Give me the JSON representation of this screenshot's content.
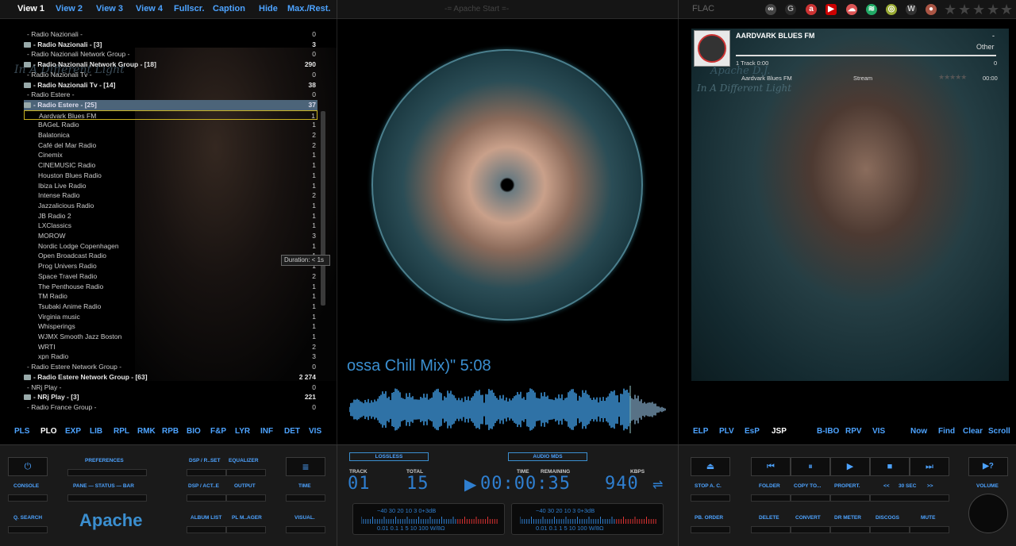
{
  "top_tabs": [
    {
      "label": "View 1",
      "active": true
    },
    {
      "label": "View 2",
      "active": false
    },
    {
      "label": "View 3",
      "active": false
    },
    {
      "label": "View 4",
      "active": false
    },
    {
      "label": "Fullscr.",
      "active": false
    },
    {
      "label": "Caption",
      "active": false
    },
    {
      "label": "Hide",
      "active": false
    },
    {
      "label": "Max./Rest.",
      "active": false
    }
  ],
  "window_title": "-= Apache Start =-",
  "format_label": "FLAC",
  "playlist_rows": [
    {
      "label": "- Radio Nazionali -",
      "count": "0",
      "bold": false,
      "folder": false,
      "indent": 0
    },
    {
      "label": "- Radio Nazionali - [3]",
      "count": "3",
      "bold": true,
      "folder": true,
      "indent": 0
    },
    {
      "label": "- Radio Nazionali Network Group -",
      "count": "0",
      "bold": false,
      "folder": false,
      "indent": 0
    },
    {
      "label": "- Radio Nazionali Network Group - [18]",
      "count": "290",
      "bold": true,
      "folder": true,
      "indent": 0
    },
    {
      "label": "- Radio Nazionali Tv -",
      "count": "0",
      "bold": false,
      "folder": false,
      "indent": 0
    },
    {
      "label": "- Radio Nazionali Tv - [14]",
      "count": "38",
      "bold": true,
      "folder": true,
      "indent": 0
    },
    {
      "label": "- Radio Estere -",
      "count": "0",
      "bold": false,
      "folder": false,
      "indent": 0
    },
    {
      "label": "- Radio Estere - [25]",
      "count": "37",
      "bold": true,
      "folder": true,
      "indent": 0,
      "selected": true
    },
    {
      "label": "Aardvark Blues FM",
      "count": "1",
      "indent": 1,
      "current": true
    },
    {
      "label": "BAGeL Radio",
      "count": "1",
      "indent": 1
    },
    {
      "label": "Balatonica",
      "count": "2",
      "indent": 1
    },
    {
      "label": "Café del Mar Radio",
      "count": "2",
      "indent": 1
    },
    {
      "label": "Cinemix",
      "count": "1",
      "indent": 1
    },
    {
      "label": "CINEMUSIC Radio",
      "count": "1",
      "indent": 1
    },
    {
      "label": "Houston Blues Radio",
      "count": "1",
      "indent": 1
    },
    {
      "label": "Ibiza Live Radio",
      "count": "1",
      "indent": 1
    },
    {
      "label": "Intense Radio",
      "count": "2",
      "indent": 1
    },
    {
      "label": "Jazzalicious Radio",
      "count": "1",
      "indent": 1
    },
    {
      "label": "JB Radio 2",
      "count": "1",
      "indent": 1
    },
    {
      "label": "LXClassics",
      "count": "1",
      "indent": 1
    },
    {
      "label": "MOROW",
      "count": "3",
      "indent": 1
    },
    {
      "label": "Nordic Lodge Copenhagen",
      "count": "1",
      "indent": 1
    },
    {
      "label": "Open Broadcast Radio",
      "count": "1",
      "indent": 1
    },
    {
      "label": "Prog Univers Radio",
      "count": "1",
      "indent": 1
    },
    {
      "label": "Space Travel Radio",
      "count": "2",
      "indent": 1
    },
    {
      "label": "The Penthouse Radio",
      "count": "1",
      "indent": 1
    },
    {
      "label": "TM Radio",
      "count": "1",
      "indent": 1
    },
    {
      "label": "Tsubaki Anime Radio",
      "count": "1",
      "indent": 1
    },
    {
      "label": "Virginia music",
      "count": "1",
      "indent": 1
    },
    {
      "label": "Whisperings",
      "count": "1",
      "indent": 1
    },
    {
      "label": "WJMX Smooth Jazz Boston",
      "count": "1",
      "indent": 1
    },
    {
      "label": "WRTI",
      "count": "2",
      "indent": 1
    },
    {
      "label": "xpn Radio",
      "count": "3",
      "indent": 1
    },
    {
      "label": "- Radio Estere Network Group -",
      "count": "0",
      "bold": false,
      "folder": false,
      "indent": 0
    },
    {
      "label": "- Radio Estere Network Group - [63]",
      "count": "2 274",
      "bold": true,
      "folder": true,
      "indent": 0
    },
    {
      "label": "- NRj Play -",
      "count": "0",
      "bold": false,
      "folder": false,
      "indent": 0
    },
    {
      "label": "- NRj Play - [3]",
      "count": "221",
      "bold": true,
      "folder": true,
      "indent": 0
    },
    {
      "label": "- Radio France Group -",
      "count": "0",
      "bold": false,
      "folder": false,
      "indent": 0
    }
  ],
  "tooltip": "Duration: < 1s",
  "left_tabs": [
    {
      "label": "PLS",
      "active": false
    },
    {
      "label": "PLO",
      "active": true
    },
    {
      "label": "EXP",
      "active": false
    },
    {
      "label": "LIB",
      "active": false
    },
    {
      "label": "RPL",
      "active": false
    },
    {
      "label": "RMK",
      "active": false
    },
    {
      "label": "RPB",
      "active": false
    },
    {
      "label": "BIO",
      "active": false
    },
    {
      "label": "F&P",
      "active": false
    },
    {
      "label": "LYR",
      "active": false
    },
    {
      "label": "INF",
      "active": false
    },
    {
      "label": "DET",
      "active": false
    },
    {
      "label": "VIS",
      "active": false
    }
  ],
  "song_scroll": "ossa Chill Mix)\" 5:08",
  "station": {
    "name": "AARDVARK BLUES FM",
    "dash": "-",
    "genre": "Other",
    "track_info": "1 Track  0:00",
    "track_count": "0",
    "row_name": "Aardvark Blues FM",
    "row_type": "Stream",
    "row_time": "00:00"
  },
  "skin_title": "Apache D.J.",
  "skin_subtitle": "In A Different Light",
  "right_tabs": [
    {
      "label": "ELP",
      "active": false
    },
    {
      "label": "PLV",
      "active": false
    },
    {
      "label": "EsP",
      "active": false
    },
    {
      "label": "JSP",
      "active": true
    },
    {
      "label": "B-IBO",
      "active": false
    },
    {
      "label": "RPV",
      "active": false
    },
    {
      "label": "VIS",
      "active": false
    },
    {
      "label": "Now",
      "active": false
    },
    {
      "label": "Find",
      "active": false
    },
    {
      "label": "Clear",
      "active": false
    },
    {
      "label": "Scroll",
      "active": false
    }
  ],
  "bottom": {
    "app_name": "Apache",
    "labels": {
      "preferences": "PREFERENCES",
      "console": "CONSOLE",
      "pane_status_bar": "PANE — STATUS — BAR",
      "q_search": "Q. SEARCH",
      "dsp_rset": "DSP / R..SET",
      "equalizer": "EQUALIZER",
      "dsp_acte": "DSP / ACT..E",
      "output": "OUTPUT",
      "album_list": "ALBUM LIST",
      "pl_manager": "PL M..AGER",
      "time": "TIME",
      "visual": "VISUAL.",
      "stop_ac": "STOP A. C.",
      "pb_order": "PB. ORDER",
      "folder": "FOLDER",
      "copy_to": "COPY TO...",
      "propert": "PROPERT.",
      "back": "<<",
      "sec30": "30 SEC",
      "fwd": ">>",
      "delete": "DELETE",
      "convert": "CONVERT",
      "dr_meter": "DR METER",
      "discogs": "DISCOGS",
      "mute": "MUTE",
      "volume": "VOLUME"
    },
    "lossless": "LOSSLESS",
    "audio_mds": "AUDIO MDS",
    "display": {
      "track_label": "TRACK",
      "track": "01",
      "total_label": "TOTAL",
      "total": "15",
      "time_label": "TIME",
      "remaining_label": "REMAINING",
      "time": "00:00:35",
      "kbps_label": "KBPS",
      "kbps": "940"
    },
    "meter_top": "−40  30  20  10  3  0+3dB",
    "meter_bottom": "0.01  0.1  1  5 10  100 W/8Ω"
  },
  "colors": {
    "accent": "#4da3ff",
    "bg": "#000000",
    "panel": "#1a1a1a"
  }
}
